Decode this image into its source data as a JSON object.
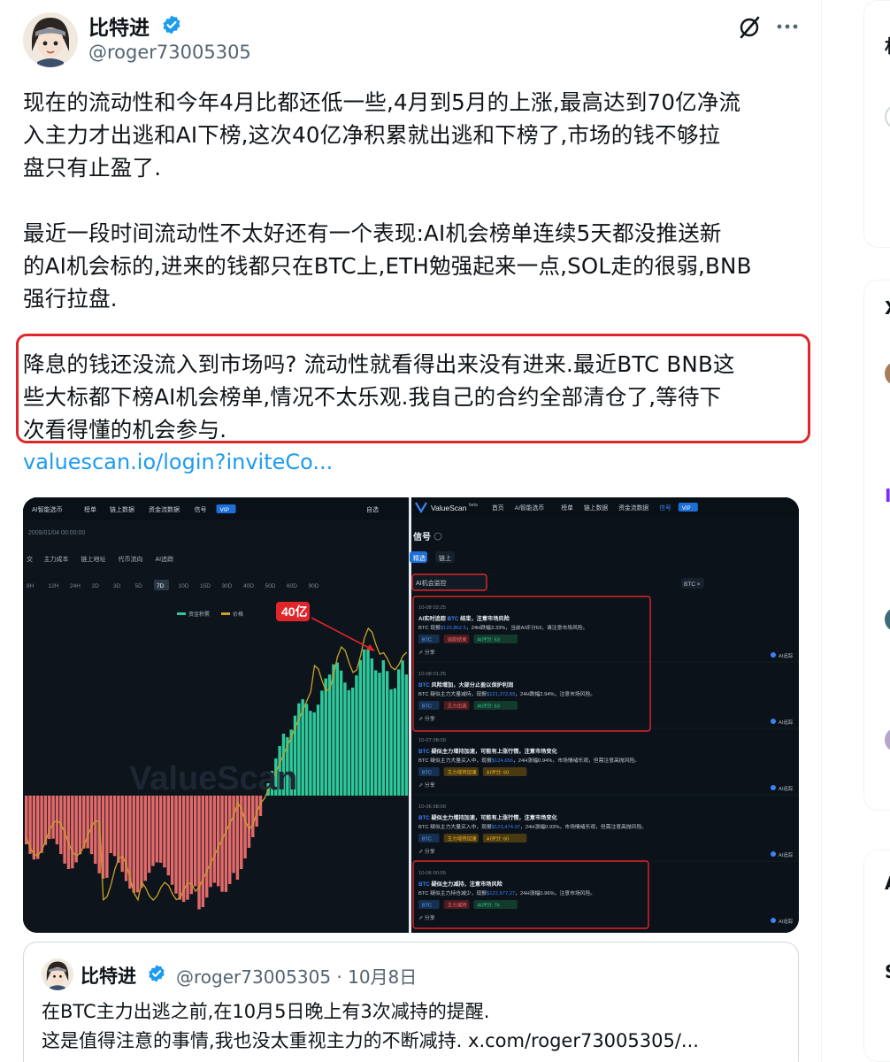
{
  "author": {
    "name": "比特进",
    "handle": "@roger73005305"
  },
  "tweet": {
    "paragraphs": [
      [
        "现在的流动性和今年4月比都还低一些,4月到5月的上涨,最高达到70亿净流",
        "入主力才出逃和AI下榜,这次40亿净积累就出逃和下榜了,市场的钱不够拉",
        "盘只有止盈了."
      ],
      [
        "最近一段时间流动性不太好还有一个表现:AI机会榜单连续5天都没推送新",
        "的AI机会标的,进来的钱都只在BTC上,ETH勉强起来一点,SOL走的很弱,BNB",
        "强行拉盘."
      ],
      [
        "降息的钱还没流入到市场吗? 流动性就看得出来没有进来.最近BTC BNB这",
        "些大标都下榜AI机会榜单,情况不太乐观.我自己的合约全部清仓了,等待下",
        "次看得懂的机会参与."
      ]
    ],
    "link": "valuescan.io/login?inviteCo..."
  },
  "media": {
    "left_panel": {
      "nav": [
        "AI智能选币",
        "榜单",
        "链上数据",
        "资金流数据",
        "信号"
      ],
      "nav_badge": "VIP",
      "nav_right": "自选",
      "date": "2009/01/04 00:00:00",
      "subtabs": [
        "交",
        "主力成本",
        "链上地址",
        "代币流向",
        "AI追踪"
      ],
      "ranges": [
        "8H",
        "12H",
        "24H",
        "2D",
        "3D",
        "5D",
        "7D",
        "10D",
        "15D",
        "30D",
        "40D",
        "50D",
        "60D",
        "90D"
      ],
      "legend": [
        "资金积累",
        "价格"
      ],
      "callout": "40亿",
      "watermark": "ValueScan"
    },
    "right_panel": {
      "brand": "ValueScan",
      "brand_tag": "beta",
      "nav": [
        "首页",
        "AI智能选币",
        "榜单",
        "链上数据",
        "资金流数据",
        "信号"
      ],
      "nav_badge": "VIP",
      "title": "信号",
      "tabs": [
        "精选",
        "链上"
      ],
      "filter": "AI机会监控",
      "token_chip": "BTC ×",
      "share": "分享",
      "side_label": "AI追踪",
      "signals": [
        {
          "time": "10-08 02:25",
          "title_a": "AI实时追踪 ",
          "title_coin": "BTC",
          "title_b": " 结束，注意市场风险",
          "line_a": "BTC 现报",
          "price": "$120,862.5",
          "line_b": "，24H跌幅3.33%，当前AI评分63，请注意市场风险。",
          "tags": [
            "BTC",
            "追踪结束",
            "AI评分: 63"
          ]
        },
        {
          "time": "10-08 01:25",
          "title_a": "",
          "title_coin": "BTC",
          "title_b": " 风险增加，大部分止盈以保护利润",
          "line_a": "BTC 疑似主力大量减持，现报",
          "price": "$121,372.89",
          "line_b": "，24H跌幅2.94%，注意市场风险。",
          "tags": [
            "BTC",
            "主力出逃",
            "AI评分: 63"
          ]
        },
        {
          "time": "10-07 08:00",
          "title_a": "",
          "title_coin": "BTC",
          "title_b": " 疑似主力增持加速，可能有上涨行情，注意市场变化",
          "line_a": "BTC 疑似主力大量买入中，现报",
          "price": "$124,656",
          "line_b": "，24H涨幅0.94%，市场情绪乐观，但需注意高抛风险。",
          "tags": [
            "BTC",
            "主力增持加速",
            "AI评分: 60"
          ]
        },
        {
          "time": "10-06 08:00",
          "title_a": "",
          "title_coin": "BTC",
          "title_b": " 疑似主力增持加速，可能有上涨行情，注意市场变化",
          "line_a": "BTC 疑似主力大量买入中，现报",
          "price": "$123,474.07",
          "line_b": "，24H涨幅0.93%，市场情绪乐观，但需注意高抛风险。",
          "tags": [
            "BTC",
            "主力增持加速",
            "AI评分: 60"
          ]
        },
        {
          "time": "10-06 00:55",
          "title_a": "",
          "title_coin": "BTC",
          "title_b": " 疑似主力减持，注意市场风险",
          "line_a": "BTC 疑似主力持仓减少，现报",
          "price": "$122,977.27",
          "line_b": "，24H涨幅0.96%，注意市场风险。",
          "tags": [
            "BTC",
            "主力减持",
            "AI评分: 76"
          ]
        }
      ]
    }
  },
  "quote": {
    "name": "比特进",
    "handle_date": "@roger73005305 · 10月8日",
    "lines": [
      "在BTC主力出逃之前,在10月5日晚上有3次减持的提醒.",
      "这是值得注意的事情,我也没太重视主力的不断减持. x.com/roger73005305/..."
    ]
  },
  "sidebar": {
    "glyphs": [
      "村",
      "X",
      "Ir",
      "Is",
      "A",
      "S"
    ]
  },
  "colors": {
    "verified": "#1d9bf0",
    "link": "#1d9bf0",
    "highlight_border": "#e0262b",
    "bar_green": "#2ec99b",
    "bar_red": "#e36a6a",
    "price_line": "#c9a227"
  }
}
